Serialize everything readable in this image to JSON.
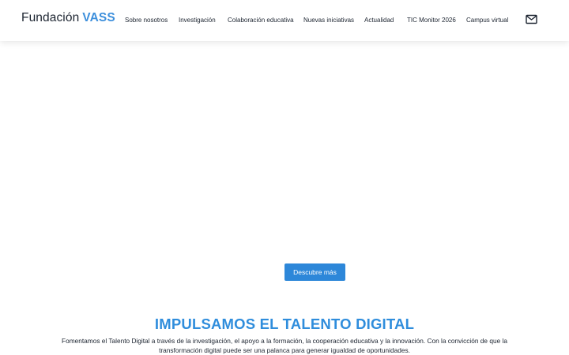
{
  "header": {
    "logo": {
      "light": "Fundación",
      "bold": "VASS"
    },
    "nav": [
      "Sobre nosotros",
      "Investigación",
      "Colaboración educativa",
      "Nuevas iniciativas",
      "Actualidad",
      "TIC Monitor 2026",
      "Campus virtual"
    ],
    "contact_icon": "mail-icon"
  },
  "hero": {
    "cta_label": "Descubre más"
  },
  "intro": {
    "headline": "IMPULSAMOS EL TALENTO DIGITAL",
    "description": "Fomentamos el Talento Digital a través de la investigación, el apoyo a la formación, la cooperación educativa y la innovación. Con la convicción de que la transformación digital puede ser una palanca para generar igualdad de oportunidades."
  },
  "colors": {
    "accent": "#2f8ddc",
    "button": "#2d87d9",
    "text": "#1c2430"
  }
}
